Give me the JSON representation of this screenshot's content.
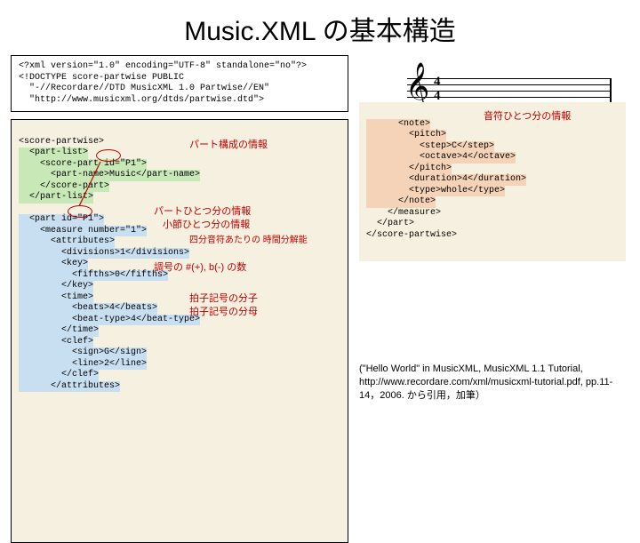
{
  "title": "Music.XML の基本構造",
  "box1": "<?xml version=\"1.0\" encoding=\"UTF-8\" standalone=\"no\"?>\n<!DOCTYPE score-partwise PUBLIC\n  \"-//Recordare//DTD MusicXML 1.0 Partwise//EN\"\n  \"http://www.musicxml.org/dtds/partwise.dtd\">",
  "box2": {
    "l1": "<score-partwise>",
    "l2": "  <part-list>",
    "l3a": "    <score-part id=",
    "l3b": "\"P1\"",
    "l3c": ">",
    "l4": "      <part-name>Music</part-name>",
    "l5": "    </score-part>",
    "l6": "  </part-list>",
    "blank1": " ",
    "l7a": "  <part id=",
    "l7b": "\"P1\"",
    "l7c": ">",
    "l8": "    <measure number=\"1\">",
    "l9": "      <attributes>",
    "l10": "        <divisions>1</divisions>",
    "l11": "        <key>",
    "l12": "          <fifths>0</fifths>",
    "l13": "        </key>",
    "l14": "        <time>",
    "l15": "          <beats>4</beats>",
    "l16": "          <beat-type>4</beat-type>",
    "l17": "        </time>",
    "l18": "        <clef>",
    "l19": "          <sign>G</sign>",
    "l20": "          <line>2</line>",
    "l21": "        </clef>",
    "l22": "      </attributes>"
  },
  "box3": {
    "l1": "      <note>",
    "l2": "        <pitch>",
    "l3": "          <step>C</step>",
    "l4": "          <octave>4</octave>",
    "l5": "        </pitch>",
    "l6": "        <duration>4</duration>",
    "l7": "        <type>whole</type>",
    "l8": "      </note>",
    "l9": "    </measure>",
    "l10": "  </part>",
    "l11": "</score-partwise>"
  },
  "annot": {
    "part_list": "パート構成の情報",
    "part": "パートひとつ分の情報",
    "measure": "小節ひとつ分の情報",
    "divisions": "四分音符あたりの\n時間分解能",
    "fifths": "調号の #(+), b(-) の数",
    "beats": "拍子記号の分子",
    "beat_type": "拍子記号の分母",
    "note": "音符ひとつ分の情報"
  },
  "citation": "(\"Hello World\" in MusicXML, MusicXML 1.1 Tutorial, http://www.recordare.com/xml/musicxml-tutorial.pdf, pp.11-14，2006. から引用，加筆）"
}
